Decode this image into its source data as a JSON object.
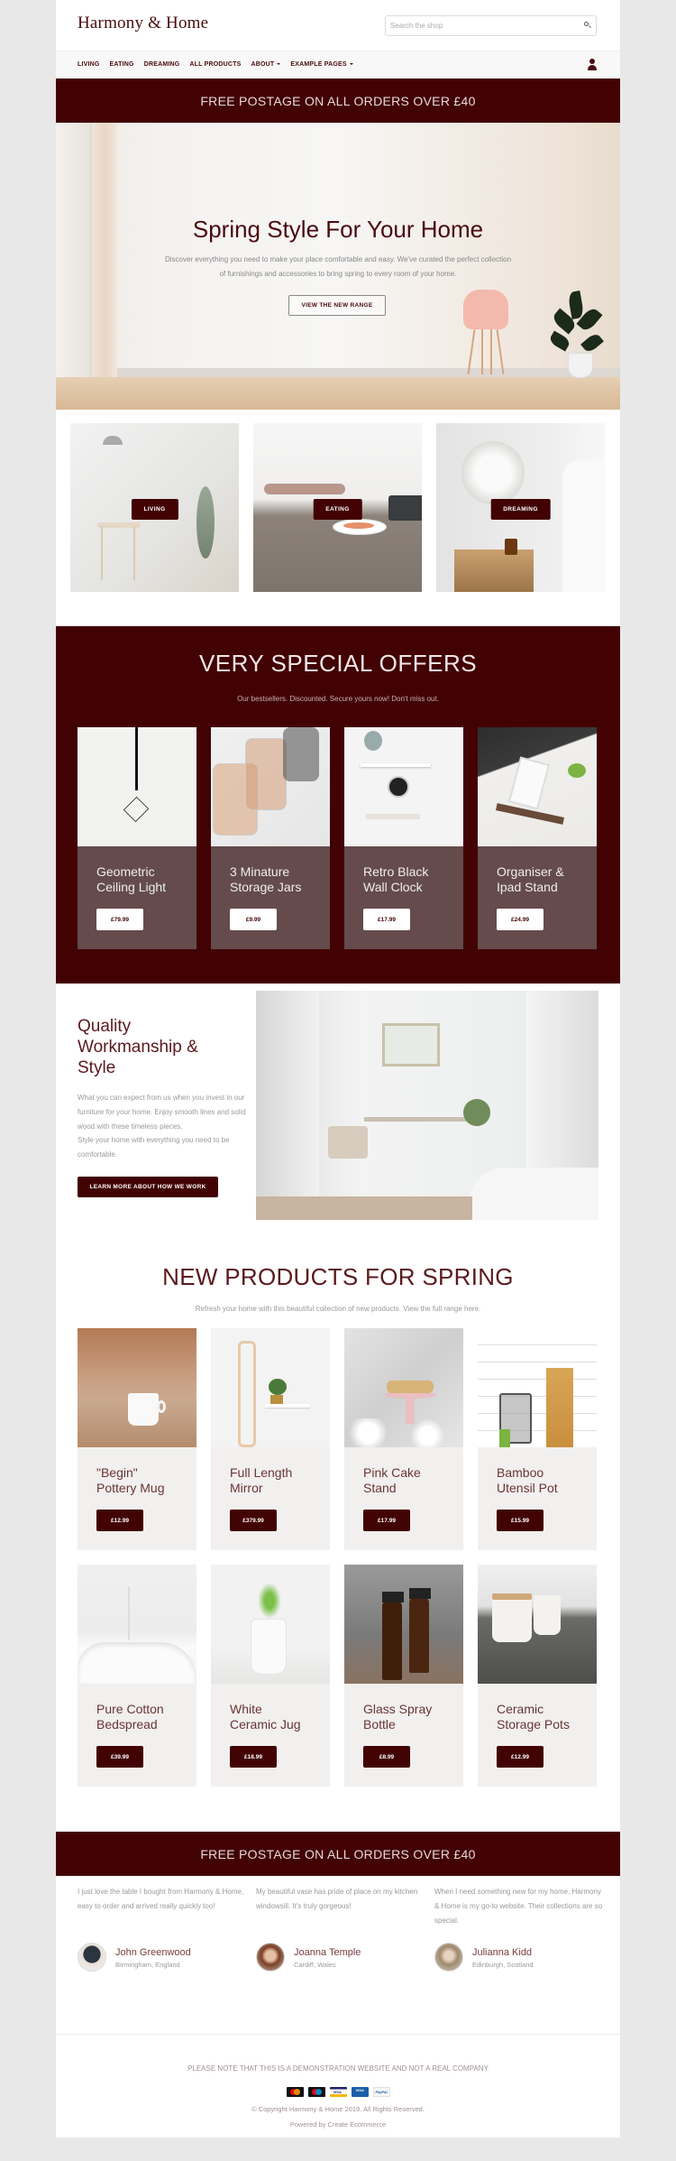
{
  "header": {
    "logo": "Harmony & Home",
    "search_placeholder": "Search the shop"
  },
  "nav": {
    "items": [
      {
        "label": "LIVING",
        "dropdown": false
      },
      {
        "label": "EATING",
        "dropdown": false
      },
      {
        "label": "DREAMING",
        "dropdown": false
      },
      {
        "label": "ALL PRODUCTS",
        "dropdown": false
      },
      {
        "label": "ABOUT",
        "dropdown": true
      },
      {
        "label": "EXAMPLE PAGES",
        "dropdown": true
      }
    ],
    "account_icon": "user-icon"
  },
  "banner_top": "FREE POSTAGE ON ALL ORDERS OVER £40",
  "hero": {
    "title": "Spring Style For Your Home",
    "text": "Discover everything you need to make your place comfortable and easy. We've curated the perfect collection of furnishings and accessories to bring spring to every room of your home.",
    "button": "VIEW THE NEW RANGE"
  },
  "categories": [
    {
      "label": "LIVING"
    },
    {
      "label": "EATING"
    },
    {
      "label": "DREAMING"
    }
  ],
  "offers": {
    "title": "VERY SPECIAL OFFERS",
    "subtitle": "Our bestsellers. Discounted. Secure yours now! Don't miss out.",
    "items": [
      {
        "name": "Geometric Ceiling Light",
        "price": "£79.99"
      },
      {
        "name": "3 Minature Storage Jars",
        "price": "£9.99"
      },
      {
        "name": "Retro Black Wall Clock",
        "price": "£17.99"
      },
      {
        "name": "Organiser & Ipad Stand",
        "price": "£24.99"
      }
    ]
  },
  "quality": {
    "title": "Quality Workmanship & Style",
    "p1": "What you can expect from us when you invest in our furniture for your home. Enjoy smooth lines and solid wood with these timeless pieces.",
    "p2": "Style your home with everything you need to be comfortable.",
    "button": "LEARN MORE ABOUT HOW WE WORK"
  },
  "new_products": {
    "title": "NEW PRODUCTS FOR SPRING",
    "subtitle": "Refresh your home with this beautiful collection of new products. View the full range here.",
    "items": [
      {
        "name": "\"Begin\" Pottery Mug",
        "price": "£12.99"
      },
      {
        "name": "Full Length Mirror",
        "price": "£379.99"
      },
      {
        "name": "Pink Cake Stand",
        "price": "£17.99"
      },
      {
        "name": "Bamboo Utensil Pot",
        "price": "£15.99"
      },
      {
        "name": "Pure Cotton Bedspread",
        "price": "£39.99"
      },
      {
        "name": "White Ceramic Jug",
        "price": "£18.99"
      },
      {
        "name": "Glass Spray Bottle",
        "price": "£8.99"
      },
      {
        "name": "Ceramic Storage Pots",
        "price": "£12.99"
      }
    ]
  },
  "banner_bottom": "FREE POSTAGE ON ALL ORDERS OVER £40",
  "testimonials": [
    {
      "quote": "I just love the table I bought from Harmony & Home, easy to order and arrived really quickly too!",
      "name": "John Greenwood",
      "location": "Birmingham, England"
    },
    {
      "quote": "My beautiful vase has pride of place on my kitchen windowsill. It's truly gorgeous!",
      "name": "Joanna Temple",
      "location": "Cardiff, Wales"
    },
    {
      "quote": "When I need something new for my home, Harmony & Home is my go-to website. Their collections are so special.",
      "name": "Julianna Kidd",
      "location": "Edinburgh, Scotland"
    }
  ],
  "footer": {
    "note": "PLEASE NOTE THAT THIS IS A DEMONSTRATION WEBSITE AND NOT A REAL COMPANY",
    "payment_icons": [
      "mastercard-icon",
      "maestro-icon",
      "visa-icon",
      "visa-electron-icon",
      "paypal-icon"
    ],
    "paypal_label": "PayPal",
    "visa_label": "VISA",
    "copyright": "© Copyright Harmony & Home 2019. All Rights Reserved.",
    "powered": "Powered by Create Ecommerce"
  },
  "colors": {
    "brand": "#420204",
    "offer_card": "#654b4c",
    "product_card": "#f1f0ee"
  }
}
